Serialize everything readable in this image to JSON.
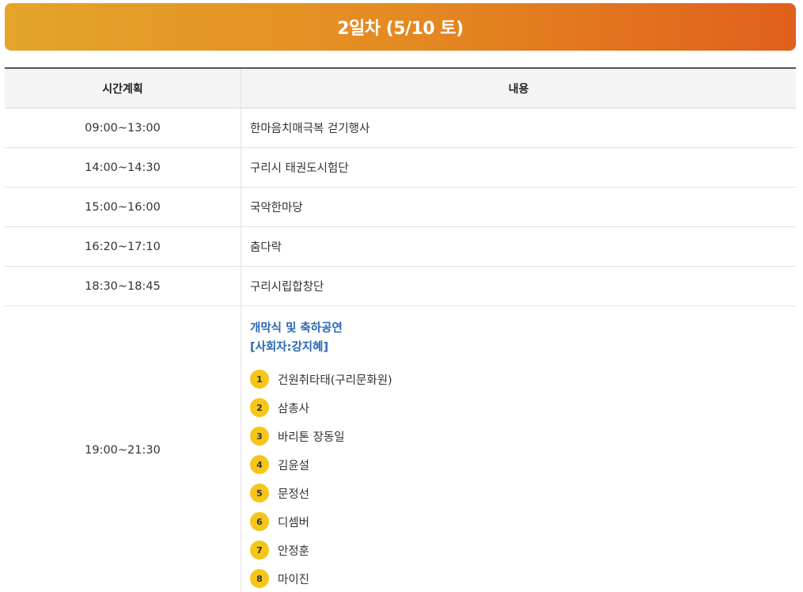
{
  "banner": {
    "title": "2일차 (5/10 토)"
  },
  "table": {
    "headers": {
      "time": "시간계획",
      "content": "내용"
    },
    "rows": [
      {
        "time": "09:00~13:00",
        "content": "한마음치매극복 걷기행사"
      },
      {
        "time": "14:00~14:30",
        "content": "구리시 태권도시험단"
      },
      {
        "time": "15:00~16:00",
        "content": "국악한마당"
      },
      {
        "time": "16:20~17:10",
        "content": "춤다락"
      },
      {
        "time": "18:30~18:45",
        "content": "구리시립합창단"
      }
    ],
    "ceremony": {
      "time": "19:00~21:30",
      "title": "개막식 및 축하공연",
      "host": "[사회자:강지혜]",
      "performers": [
        {
          "num": "1",
          "name": "건원취타태(구리문화원)"
        },
        {
          "num": "2",
          "name": "삼총사"
        },
        {
          "num": "3",
          "name": "바리톤 장동일"
        },
        {
          "num": "4",
          "name": "김윤설"
        },
        {
          "num": "5",
          "name": "문정선"
        },
        {
          "num": "6",
          "name": "디셈버"
        },
        {
          "num": "7",
          "name": "안정훈"
        },
        {
          "num": "8",
          "name": "마이진"
        }
      ]
    }
  },
  "colors": {
    "banner_gradient": [
      "#e4a52a",
      "#e0601c"
    ],
    "event_title": "#2a66b4",
    "badge": "#f5c518"
  }
}
